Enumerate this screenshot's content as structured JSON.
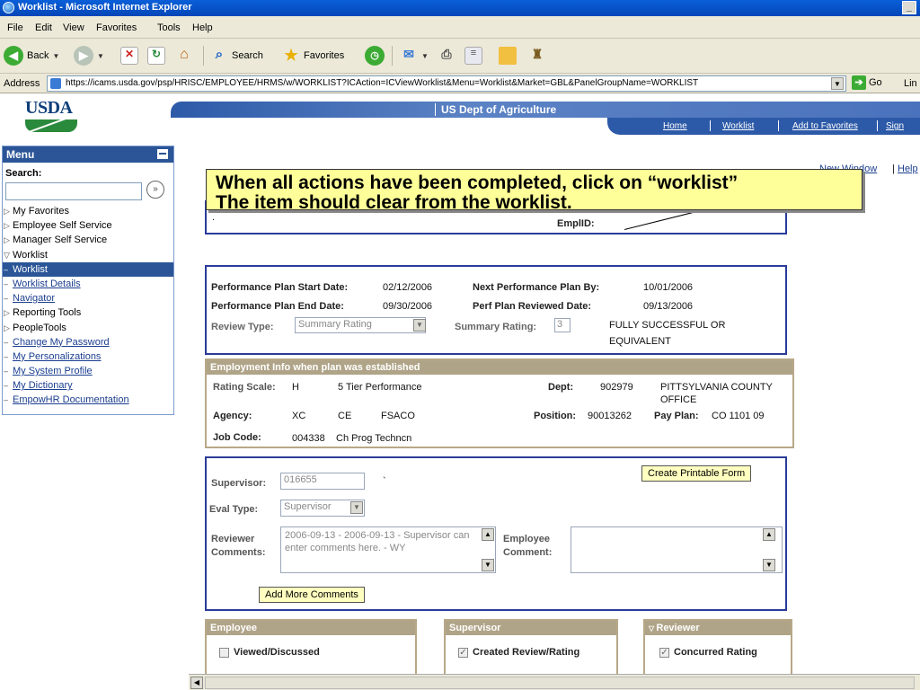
{
  "window": {
    "title": "Worklist - Microsoft Internet Explorer",
    "min_glyph": "_"
  },
  "menubar": {
    "items": [
      "File",
      "Edit",
      "View",
      "Favorites",
      "Tools",
      "Help"
    ]
  },
  "toolbar": {
    "back_label": "Back",
    "search_label": "Search",
    "favorites_label": "Favorites"
  },
  "address": {
    "label": "Address",
    "url": "https://icams.usda.gov/psp/HRISC/EMPLOYEE/HRMS/w/WORKLIST?ICAction=ICViewWorklist&Menu=Worklist&Market=GBL&PanelGroupName=WORKLIST",
    "go_label": "Go",
    "links_label": "Lin"
  },
  "header": {
    "logo_text": "USDA",
    "agency": "US Dept of Agriculture",
    "nav": [
      "Home",
      "Worklist",
      "Add to Favorites",
      "Sign"
    ]
  },
  "right_links": {
    "new_window": "New Window",
    "help": "Help"
  },
  "sidebar": {
    "title": "Menu",
    "search_label": "Search:",
    "search_go": "»",
    "items": [
      {
        "label": "My Favorites",
        "marker": "▷",
        "type": "plain"
      },
      {
        "label": "Employee Self Service",
        "marker": "▷",
        "type": "plain"
      },
      {
        "label": "Manager Self Service",
        "marker": "▷",
        "type": "plain"
      },
      {
        "label": "Worklist",
        "marker": "▽",
        "type": "plain"
      },
      {
        "label": "Worklist",
        "marker": "–",
        "type": "selected"
      },
      {
        "label": "Worklist Details",
        "marker": "–",
        "type": "link"
      },
      {
        "label": "Navigator",
        "marker": "–",
        "type": "link"
      },
      {
        "label": "Reporting Tools",
        "marker": "▷",
        "type": "plain"
      },
      {
        "label": "PeopleTools",
        "marker": "▷",
        "type": "plain"
      },
      {
        "label": "Change My Password",
        "marker": "–",
        "type": "link"
      },
      {
        "label": "My Personalizations",
        "marker": "–",
        "type": "link"
      },
      {
        "label": "My System Profile",
        "marker": "–",
        "type": "link"
      },
      {
        "label": "My Dictionary",
        "marker": "–",
        "type": "link"
      },
      {
        "label": "EmpowHR Documentation",
        "marker": "–",
        "type": "link"
      }
    ]
  },
  "callout": {
    "line1": "When all actions have been completed, click on “worklist”",
    "line2": "The item should clear from the worklist."
  },
  "employee": {
    "emplid_label": "EmplID:",
    "dot": "."
  },
  "plan": {
    "start_label": "Performance Plan Start Date:",
    "start_value": "02/12/2006",
    "end_label": "Performance Plan End Date:",
    "end_value": "09/30/2006",
    "next_label": "Next Performance Plan By:",
    "next_value": "10/01/2006",
    "reviewed_label": "Perf Plan Reviewed Date:",
    "reviewed_value": "09/13/2006",
    "review_type_label": "Review Type:",
    "review_type_value": "Summary Rating",
    "summary_label": "Summary Rating:",
    "summary_value": "3",
    "summary_text_1": "FULLY SUCCESSFUL OR",
    "summary_text_2": "EQUIVALENT"
  },
  "employment": {
    "title": "Employment Info when plan was established",
    "rating_scale_label": "Rating Scale:",
    "rating_scale_code": "H",
    "rating_scale_text": "5 Tier Performance",
    "dept_label": "Dept:",
    "dept_code": "902979",
    "dept_name_1": "PITTSYLVANIA COUNTY",
    "dept_name_2": "OFFICE",
    "agency_label": "Agency:",
    "agency_1": "XC",
    "agency_2": "CE",
    "agency_3": "FSACO",
    "position_label": "Position:",
    "position_value": "90013262",
    "payplan_label": "Pay Plan:",
    "payplan_value": "CO  1101  09",
    "jobcode_label": "Job Code:",
    "jobcode_value": "004338",
    "jobcode_text": "Ch Prog Techncn"
  },
  "review": {
    "supervisor_label": "Supervisor:",
    "supervisor_value": "016655",
    "supervisor_mark": "`",
    "eval_type_label": "Eval Type:",
    "eval_type_value": "Supervisor",
    "print_button": "Create Printable Form",
    "reviewer_label_1": "Reviewer",
    "reviewer_label_2": "Comments:",
    "reviewer_comment": "2006-09-13 - 2006-09-13 - Supervisor can enter comments here. - WY",
    "employee_label_1": "Employee",
    "employee_label_2": "Comment:",
    "add_button": "Add More Comments"
  },
  "sections": [
    {
      "title": "Employee",
      "check_label": "Viewed/Discussed",
      "checked": false
    },
    {
      "title": "Supervisor",
      "check_label": "Created Review/Rating",
      "checked": true
    },
    {
      "title": "Reviewer",
      "check_label": "Concurred Rating",
      "checked": true
    }
  ]
}
